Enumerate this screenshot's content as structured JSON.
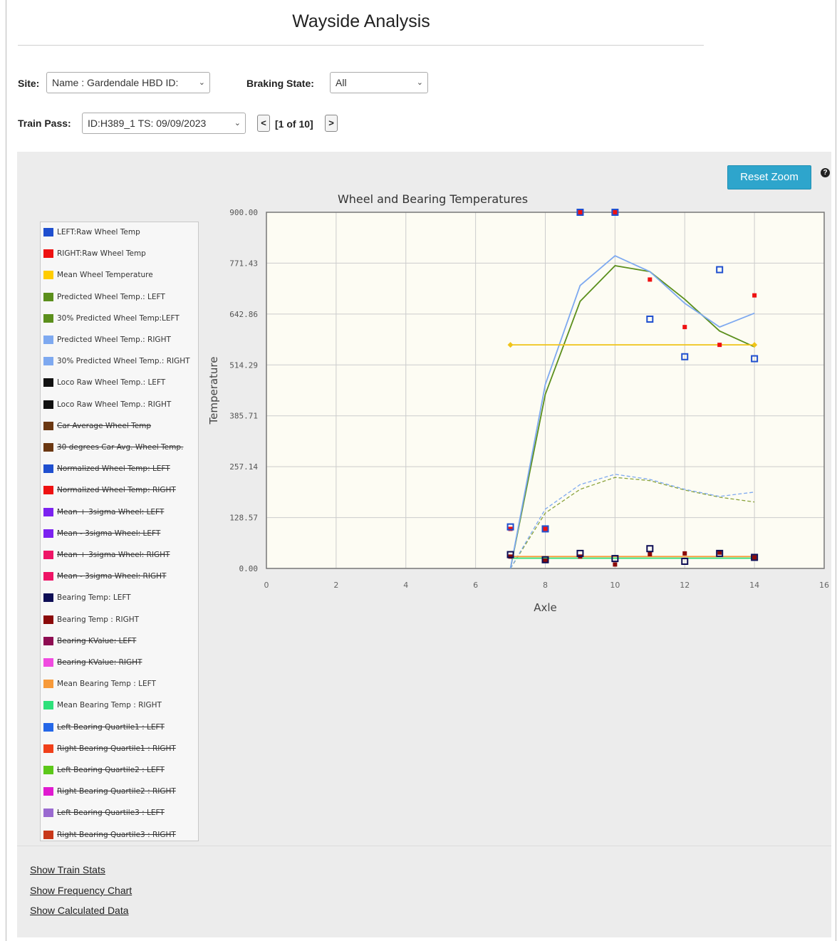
{
  "page": {
    "title": "Wayside Analysis"
  },
  "filters": {
    "site_label": "Site:",
    "site_value": "Name : Gardendale HBD ID:",
    "braking_label": "Braking State:",
    "braking_value": "All",
    "train_pass_label": "Train Pass:",
    "train_pass_value": "ID:H389_1 TS: 09/09/2023",
    "prev_label": "<",
    "next_label": ">",
    "pager_text": "[1 of 10]"
  },
  "toolbar": {
    "reset_zoom": "Reset Zoom",
    "help_icon": "question-circle-icon",
    "help_glyph": "?"
  },
  "legend": [
    {
      "label": "LEFT:Raw Wheel Temp",
      "color": "#1f4fcf",
      "hidden": false
    },
    {
      "label": "RIGHT:Raw Wheel Temp",
      "color": "#ee1111",
      "hidden": false
    },
    {
      "label": "Mean Wheel Temperature",
      "color": "#ffcc00",
      "hidden": false
    },
    {
      "label": "Predicted Wheel Temp.: LEFT",
      "color": "#5b8f1c",
      "hidden": false
    },
    {
      "label": "30% Predicted Wheel Temp:LEFT",
      "color": "#5b8f1c",
      "hidden": false
    },
    {
      "label": "Predicted Wheel Temp.: RIGHT",
      "color": "#7ea9f0",
      "hidden": false
    },
    {
      "label": "30% Predicted Wheel Temp.: RIGHT",
      "color": "#7ea9f0",
      "hidden": false
    },
    {
      "label": "Loco Raw Wheel Temp.: LEFT",
      "color": "#111111",
      "hidden": false
    },
    {
      "label": "Loco Raw Wheel Temp.: RIGHT",
      "color": "#111111",
      "hidden": false
    },
    {
      "label": "Car Average Wheel Temp",
      "color": "#6b3812",
      "hidden": true
    },
    {
      "label": "30 degrees Car Avg. Wheel Temp.",
      "color": "#6b3812",
      "hidden": true
    },
    {
      "label": "Normalized Wheel Temp: LEFT",
      "color": "#1f4fcf",
      "hidden": true
    },
    {
      "label": "Normalized Wheel Temp: RIGHT",
      "color": "#ee1111",
      "hidden": true
    },
    {
      "label": "Mean + 3sigma Wheel: LEFT",
      "color": "#7b22f0",
      "hidden": true
    },
    {
      "label": "Mean - 3sigma Wheel: LEFT",
      "color": "#7b22f0",
      "hidden": true
    },
    {
      "label": "Mean + 3sigma Wheel: RIGHT",
      "color": "#ee1466",
      "hidden": true
    },
    {
      "label": "Mean - 3sigma Wheel: RIGHT",
      "color": "#ee1466",
      "hidden": true
    },
    {
      "label": "Bearing Temp: LEFT",
      "color": "#0d0d55",
      "hidden": false
    },
    {
      "label": "Bearing Temp : RIGHT",
      "color": "#8b0a0a",
      "hidden": false
    },
    {
      "label": "Bearing KValue: LEFT",
      "color": "#8e0d52",
      "hidden": true
    },
    {
      "label": "Bearing KValue: RIGHT",
      "color": "#f04be0",
      "hidden": true
    },
    {
      "label": "Mean Bearing Temp : LEFT",
      "color": "#f79a3a",
      "hidden": false
    },
    {
      "label": "Mean Bearing Temp : RIGHT",
      "color": "#2ee07a",
      "hidden": false
    },
    {
      "label": "Left Bearing Quartile1 : LEFT",
      "color": "#2467e8",
      "hidden": true
    },
    {
      "label": "Right Bearing Quartile1 : RIGHT",
      "color": "#f0401a",
      "hidden": true
    },
    {
      "label": "Left Bearing Quartile2 : LEFT",
      "color": "#5cc81a",
      "hidden": true
    },
    {
      "label": "Right Bearing Quartile2 : RIGHT",
      "color": "#e01ad0",
      "hidden": true
    },
    {
      "label": "Left Bearing Quartile3 : LEFT",
      "color": "#9a6ad0",
      "hidden": true
    },
    {
      "label": "Right Bearing Quartile3 : RIGHT",
      "color": "#c8381a",
      "hidden": true
    }
  ],
  "links": {
    "train_stats": "Show Train Stats",
    "frequency_chart": "Show Frequency Chart",
    "calculated_data": "Show Calculated Data"
  },
  "chart_data": {
    "type": "line",
    "title": "Wheel and Bearing Temperatures",
    "xlabel": "Axle",
    "ylabel": "Temperature",
    "xlim": [
      0,
      16
    ],
    "ylim": [
      0,
      900
    ],
    "xticks": [
      "0",
      "2",
      "4",
      "6",
      "8",
      "10",
      "12",
      "14",
      "16"
    ],
    "yticks": [
      "0.00",
      "128.57",
      "257.14",
      "385.71",
      "514.29",
      "642.86",
      "771.43",
      "900.00"
    ],
    "grid": true,
    "colors": {
      "left_raw": "#1f4fcf",
      "right_raw": "#ee1111",
      "mean_wheel": "#f0c419",
      "pred_left": "#5b8f1c",
      "pred_right": "#7ea9f0",
      "bearing_left": "#0d0d55",
      "bearing_right": "#8b0a0a",
      "mean_bearing_left": "#f79a3a",
      "mean_bearing_right": "#2ee07a",
      "plot_bg": "#fdfcf3",
      "grid": "#cccccc"
    },
    "series": [
      {
        "name": "LEFT:Raw Wheel Temp",
        "kind": "square-hollow",
        "color": "#1f4fcf",
        "x": [
          7,
          8,
          9,
          10,
          11,
          12,
          13,
          14
        ],
        "y": [
          105,
          100,
          900,
          900,
          630,
          535,
          755,
          530
        ]
      },
      {
        "name": "RIGHT:Raw Wheel Temp",
        "kind": "square-filled",
        "color": "#ee1111",
        "x": [
          7,
          8,
          9,
          10,
          11,
          12,
          13,
          14
        ],
        "y": [
          100,
          100,
          900,
          900,
          730,
          610,
          565,
          690
        ]
      },
      {
        "name": "Mean Wheel Temperature",
        "kind": "line-diamond",
        "color": "#f0c419",
        "x": [
          7,
          14
        ],
        "y": [
          565,
          565
        ]
      },
      {
        "name": "Predicted Wheel Temp.: LEFT",
        "kind": "line",
        "color": "#5b8f1c",
        "x": [
          7,
          8,
          9,
          10,
          11,
          12,
          13,
          14
        ],
        "y": [
          0,
          440,
          675,
          765,
          750,
          680,
          600,
          560
        ]
      },
      {
        "name": "30% Predicted Wheel Temp:LEFT",
        "kind": "dashed",
        "color": "#8aa33c",
        "x": [
          7,
          8,
          9,
          10,
          11,
          12,
          13,
          14
        ],
        "y": [
          0,
          140,
          200,
          230,
          222,
          198,
          180,
          168
        ]
      },
      {
        "name": "Predicted Wheel Temp.: RIGHT",
        "kind": "line",
        "color": "#7ea9f0",
        "x": [
          7,
          8,
          9,
          10,
          11,
          12,
          13,
          14
        ],
        "y": [
          0,
          465,
          715,
          790,
          750,
          670,
          610,
          645
        ]
      },
      {
        "name": "30% Predicted Wheel Temp.: RIGHT",
        "kind": "dashed",
        "color": "#7ea9f0",
        "x": [
          7,
          8,
          9,
          10,
          11,
          12,
          13,
          14
        ],
        "y": [
          0,
          150,
          212,
          238,
          225,
          200,
          182,
          193
        ]
      },
      {
        "name": "Bearing Temp: LEFT",
        "kind": "square-hollow",
        "color": "#0d0d55",
        "x": [
          7,
          8,
          9,
          10,
          11,
          12,
          13,
          14
        ],
        "y": [
          35,
          22,
          38,
          25,
          50,
          18,
          38,
          28
        ]
      },
      {
        "name": "Bearing Temp : RIGHT",
        "kind": "square-filled",
        "color": "#8b0a0a",
        "x": [
          7,
          8,
          9,
          10,
          11,
          12,
          13,
          14
        ],
        "y": [
          30,
          20,
          30,
          10,
          36,
          38,
          40,
          28
        ]
      },
      {
        "name": "Mean Bearing Temp : LEFT",
        "kind": "line",
        "color": "#f79a3a",
        "x": [
          7,
          14
        ],
        "y": [
          30,
          30
        ]
      },
      {
        "name": "Mean Bearing Temp : RIGHT",
        "kind": "line",
        "color": "#2ee07a",
        "x": [
          7,
          14
        ],
        "y": [
          26,
          26
        ]
      }
    ]
  }
}
